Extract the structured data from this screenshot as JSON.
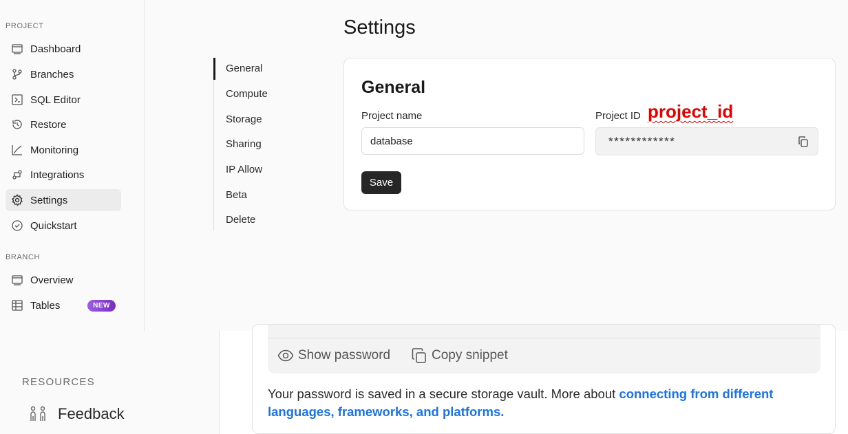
{
  "sidebar": {
    "project_label": "PROJECT",
    "project_items": [
      {
        "label": "Dashboard",
        "icon": "dashboard-icon"
      },
      {
        "label": "Branches",
        "icon": "branches-icon"
      },
      {
        "label": "SQL Editor",
        "icon": "sql-editor-icon"
      },
      {
        "label": "Restore",
        "icon": "restore-icon"
      },
      {
        "label": "Monitoring",
        "icon": "monitoring-icon"
      },
      {
        "label": "Integrations",
        "icon": "integrations-icon"
      },
      {
        "label": "Settings",
        "icon": "gear-icon",
        "active": true
      },
      {
        "label": "Quickstart",
        "icon": "check-circle-icon"
      }
    ],
    "branch_label": "BRANCH",
    "branch_items": [
      {
        "label": "Overview",
        "icon": "overview-icon"
      },
      {
        "label": "Tables",
        "icon": "table-icon",
        "badge": "NEW"
      }
    ],
    "badge_colors": [
      "#9b5de5",
      "#7b2cbf"
    ]
  },
  "page": {
    "title": "Settings"
  },
  "sub_nav": {
    "items": [
      "General",
      "Compute",
      "Storage",
      "Sharing",
      "IP Allow",
      "Beta",
      "Delete"
    ],
    "active": "General"
  },
  "general_card": {
    "title": "General",
    "project_name_label": "Project name",
    "project_name_value": "database",
    "project_id_label": "Project ID",
    "project_id_masked": "************",
    "annotation": "project_id",
    "save_label": "Save"
  },
  "resources": {
    "label": "RESOURCES",
    "feedback_label": "Feedback"
  },
  "connection": {
    "show_password_label": "Show password",
    "copy_snippet_label": "Copy snippet",
    "vault_text": "Your password is saved in a secure storage vault. More about ",
    "vault_link": "connecting from different languages, frameworks, and platforms."
  },
  "colors": {
    "annotation": "#e60000",
    "link": "#1a73e8",
    "save_button": "#262626"
  }
}
